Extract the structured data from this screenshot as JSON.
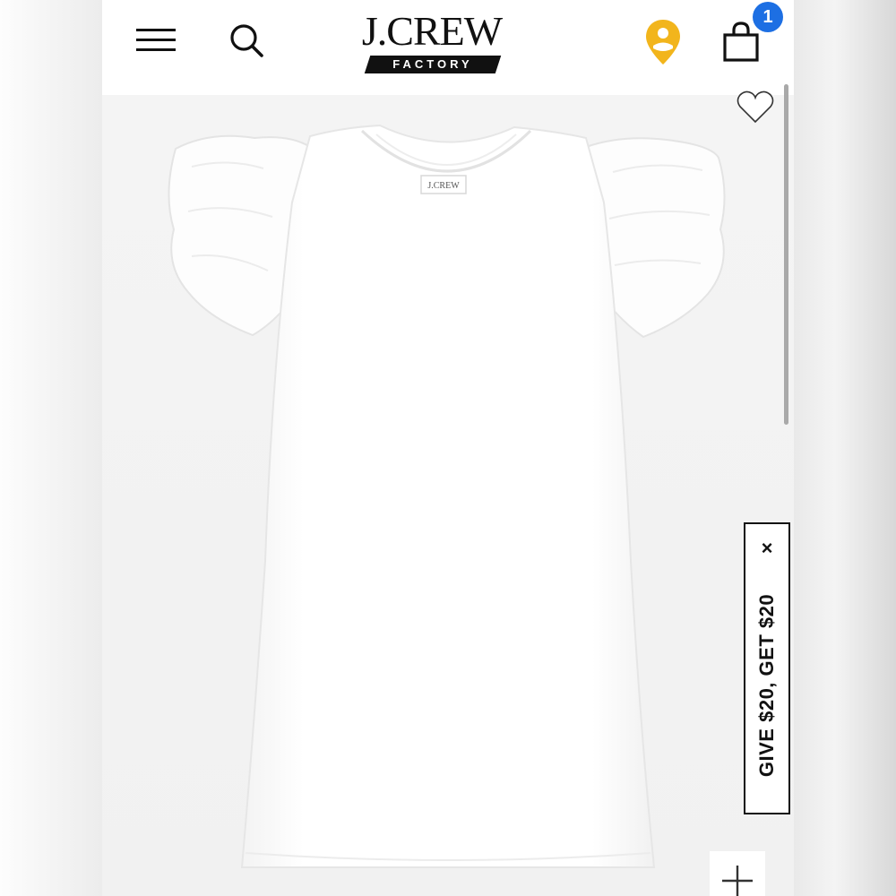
{
  "header": {
    "menu_icon": "hamburger-menu-icon",
    "search_icon": "search-icon",
    "logo": {
      "main": "J.CREW",
      "sub": "FACTORY"
    },
    "account_icon": "account-location-pin-icon",
    "bag_icon": "shopping-bag-icon",
    "bag_count": "1"
  },
  "product": {
    "image": "white-ruffle-sleeve-t-shirt-dress",
    "garment_tag": "J.CREW",
    "wishlist_icon": "heart-outline-icon",
    "zoom_icon": "plus-icon"
  },
  "promo": {
    "label": "GIVE $20, GET $20",
    "close": "×"
  },
  "colors": {
    "accent_badge": "#1d6fe3",
    "account_icon": "#f2b51c",
    "text": "#111111"
  }
}
